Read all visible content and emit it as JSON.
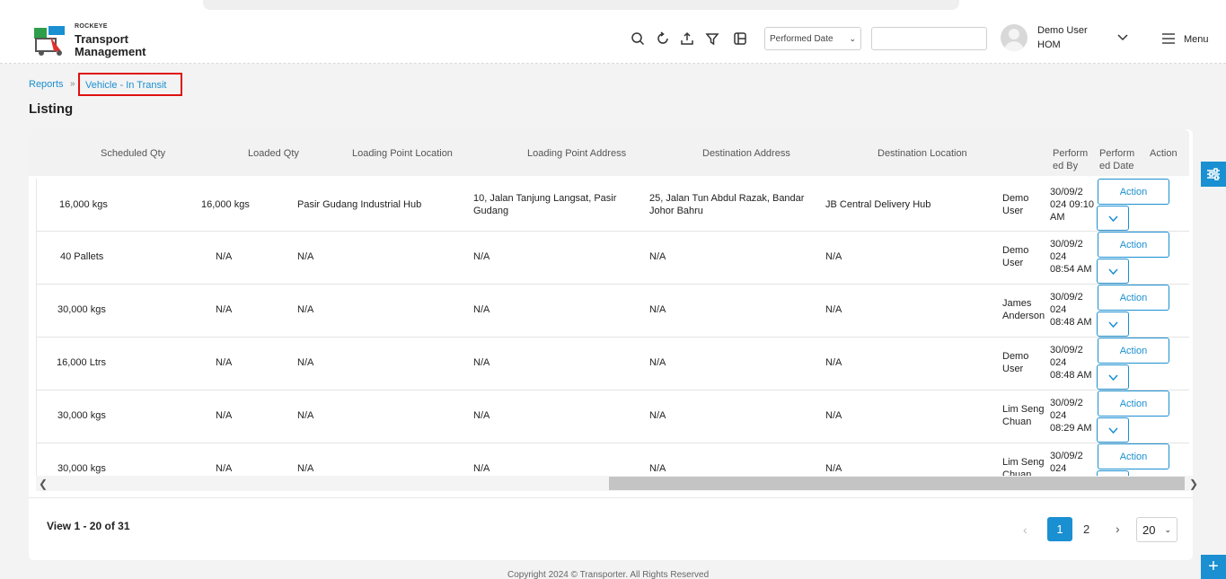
{
  "app": {
    "brand_small": "ROCKEYE",
    "brand_line1": "Transport",
    "brand_line2": "Management"
  },
  "toolbar": {
    "icons": [
      "search-icon",
      "refresh-icon",
      "upload-icon",
      "filter-icon",
      "columns-icon"
    ],
    "date_filter_value": "Performed Date",
    "search_value": ""
  },
  "user": {
    "name": "Demo User",
    "role": "HOM",
    "menu_label": "Menu"
  },
  "breadcrumb": {
    "root": "Reports",
    "separator": "»",
    "current": "Vehicle - In Transit"
  },
  "page": {
    "title": "Listing"
  },
  "table": {
    "headers": [
      "Scheduled Qty",
      "Loaded Qty",
      "Loading Point Location",
      "Loading Point Address",
      "Destination Address",
      "Destination Location",
      "Perform ed By",
      "Perform ed Date",
      "Action"
    ],
    "header_lines": {
      "performed_by_1": "Perform",
      "performed_by_2": "ed By",
      "performed_date_1": "Perform",
      "performed_date_2": "ed Date"
    },
    "rows": [
      {
        "scheduled_qty": "16,000 kgs",
        "loaded_qty": "16,000 kgs",
        "loading_location": "Pasir Gudang Industrial Hub",
        "loading_address_1": "10, Jalan Tanjung Langsat, Pasir",
        "loading_address_2": "Gudang",
        "dest_address_1": "25, Jalan Tun Abdul Razak, Bandar",
        "dest_address_2": "Johor Bahru",
        "dest_location": "JB Central Delivery Hub",
        "by_1": "Demo",
        "by_2": "User",
        "date_1": "30/09/2",
        "date_2": "024 09:10",
        "date_3": "AM",
        "action": "Action"
      },
      {
        "scheduled_qty": "40 Pallets",
        "loaded_qty": "N/A",
        "loading_location": "N/A",
        "loading_address_1": "N/A",
        "loading_address_2": "",
        "dest_address_1": "N/A",
        "dest_address_2": "",
        "dest_location": "N/A",
        "by_1": "Demo",
        "by_2": "User",
        "date_1": "30/09/2",
        "date_2": "024",
        "date_3": "08:54 AM",
        "action": "Action"
      },
      {
        "scheduled_qty": "30,000 kgs",
        "loaded_qty": "N/A",
        "loading_location": "N/A",
        "loading_address_1": "N/A",
        "loading_address_2": "",
        "dest_address_1": "N/A",
        "dest_address_2": "",
        "dest_location": "N/A",
        "by_1": "James",
        "by_2": "Anderson",
        "date_1": "30/09/2",
        "date_2": "024",
        "date_3": "08:48 AM",
        "action": "Action"
      },
      {
        "scheduled_qty": "16,000 Ltrs",
        "loaded_qty": "N/A",
        "loading_location": "N/A",
        "loading_address_1": "N/A",
        "loading_address_2": "",
        "dest_address_1": "N/A",
        "dest_address_2": "",
        "dest_location": "N/A",
        "by_1": "Demo",
        "by_2": "User",
        "date_1": "30/09/2",
        "date_2": "024",
        "date_3": "08:48 AM",
        "action": "Action"
      },
      {
        "scheduled_qty": "30,000 kgs",
        "loaded_qty": "N/A",
        "loading_location": "N/A",
        "loading_address_1": "N/A",
        "loading_address_2": "",
        "dest_address_1": "N/A",
        "dest_address_2": "",
        "dest_location": "N/A",
        "by_1": "Lim Seng",
        "by_2": "Chuan",
        "date_1": "30/09/2",
        "date_2": "024",
        "date_3": "08:29 AM",
        "action": "Action"
      },
      {
        "scheduled_qty": "30,000 kgs",
        "loaded_qty": "N/A",
        "loading_location": "N/A",
        "loading_address_1": "N/A",
        "loading_address_2": "",
        "dest_address_1": "N/A",
        "dest_address_2": "",
        "dest_location": "N/A",
        "by_1": "Lim Seng",
        "by_2": "Chuan",
        "date_1": "30/09/2",
        "date_2": "024",
        "date_3": "",
        "action": "Action"
      }
    ]
  },
  "pagination": {
    "summary": "View 1 - 20 of 31",
    "prev": "‹",
    "pages": [
      "1",
      "2"
    ],
    "current_page": "1",
    "next": "›",
    "page_size": "20"
  },
  "footer": {
    "copyright": "Copyright 2024 © Transporter. All Rights Reserved"
  },
  "colors": {
    "accent": "#1a8fd1",
    "highlight_border": "#e01010",
    "page_bg": "#f3f3f3"
  }
}
